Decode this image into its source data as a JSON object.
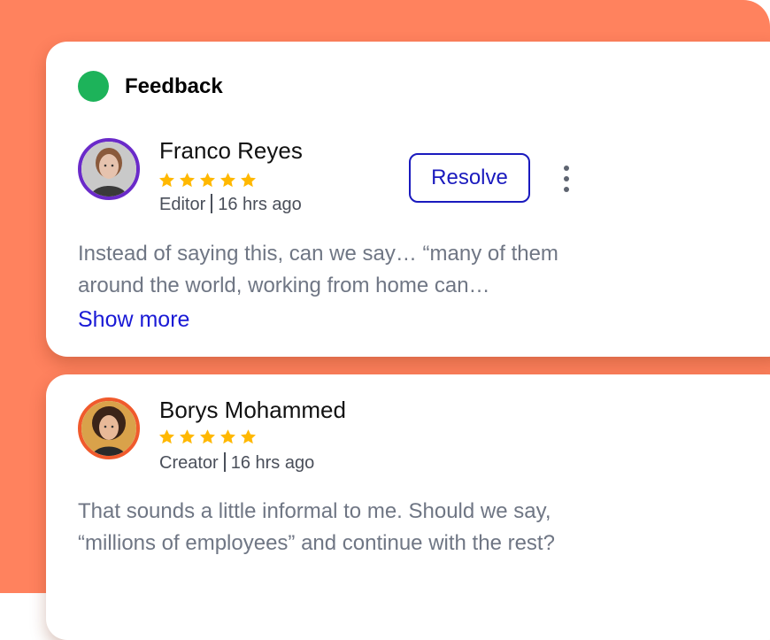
{
  "colors": {
    "background": "#FF825E",
    "status_dot": "#1DB35A",
    "star": "#FFB800",
    "link": "#1A1AD6",
    "button_border": "#1A1ABE",
    "avatar_ring_1": "#6A2AC9",
    "avatar_ring_2": "#F05A2C"
  },
  "feedback": {
    "title": "Feedback",
    "status_icon": "green-dot-icon",
    "comments": [
      {
        "name": "Franco Reyes",
        "rating": 5,
        "role": "Editor",
        "time": "16 hrs ago",
        "text": "Instead of saying this, can we say… “many of them around the world, working from home can…",
        "show_more_label": "Show more",
        "resolve_label": "Resolve",
        "menu_icon": "more-vertical-icon"
      },
      {
        "name": "Borys Mohammed",
        "rating": 5,
        "role": "Creator",
        "time": "16 hrs ago",
        "text": "That sounds a little informal to me. Should we say, “millions of employees” and continue with the rest?"
      }
    ]
  }
}
